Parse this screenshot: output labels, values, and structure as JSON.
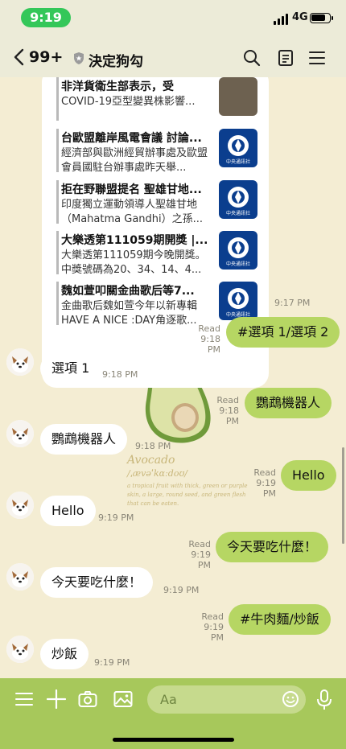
{
  "status": {
    "time": "9:19",
    "network": "4G"
  },
  "header": {
    "back_count": "99+",
    "title": "決定狗勾"
  },
  "news": [
    {
      "title": "非洋貨衛生部表示，受",
      "summary": "COVID-19亞型變異株影響...",
      "thumb": "photo"
    },
    {
      "title": "台歐盟離岸風電會議 討論...",
      "summary": "經濟部與歐洲經貿辦事處及歐盟會員國駐台辦事處昨天舉...",
      "thumb": "cna"
    },
    {
      "title": "拒在野聯盟提名 聖雄甘地...",
      "summary": "印度獨立運動領導人聖雄甘地（Mahatma Gandhi）之孫...",
      "thumb": "cna"
    },
    {
      "title": "大樂透第111059期開獎 |...",
      "summary": "大樂透第111059期今晚開獎。中獎號碼為20、34、14、4...",
      "thumb": "cna"
    },
    {
      "title": "魏如萱叩關金曲歌后等7...",
      "summary": "金曲歌后魏如萱今年以新專輯HAVE A NICE :DAY角逐歌...",
      "thumb": "cna"
    }
  ],
  "cna_label": "中央通訊社",
  "news_time": "9:17 PM",
  "messages": [
    {
      "side": "out",
      "text": "#選項 1/選項 2",
      "read": "Read",
      "time": "9:18 PM"
    },
    {
      "side": "in",
      "text": "選項 1",
      "time": "9:18 PM"
    },
    {
      "side": "out",
      "text": "鸚鵡機器人",
      "read": "Read",
      "time": "9:18 PM"
    },
    {
      "side": "in",
      "text": "鸚鵡機器人",
      "time": "9:18 PM"
    },
    {
      "side": "out",
      "text": "Hello",
      "read": "Read",
      "time": "9:19 PM"
    },
    {
      "side": "in",
      "text": "Hello",
      "time": "9:19 PM"
    },
    {
      "side": "out",
      "text": "今天要吃什麼！",
      "read": "Read",
      "time": "9:19 PM"
    },
    {
      "side": "in",
      "text": "今天要吃什麼！",
      "time": "9:19 PM"
    },
    {
      "side": "out",
      "text": "#牛肉麵/炒飯",
      "read": "Read",
      "time": "9:19 PM"
    },
    {
      "side": "in",
      "text": "炒飯",
      "time": "9:19 PM"
    }
  ],
  "background_art": {
    "title": "Avocado",
    "phonetic": "/ˌævəˈkɑːdoʊ/",
    "description": "a tropical fruit with thick, green or purple skin, a large, round seed, and green flesh that can be eaten."
  },
  "input": {
    "placeholder": "Aa"
  },
  "colors": {
    "outgoing_bubble": "#b6d663",
    "incoming_bubble": "#ffffff",
    "bottom_bar": "#a7c85b",
    "time_pill": "#34c759"
  }
}
